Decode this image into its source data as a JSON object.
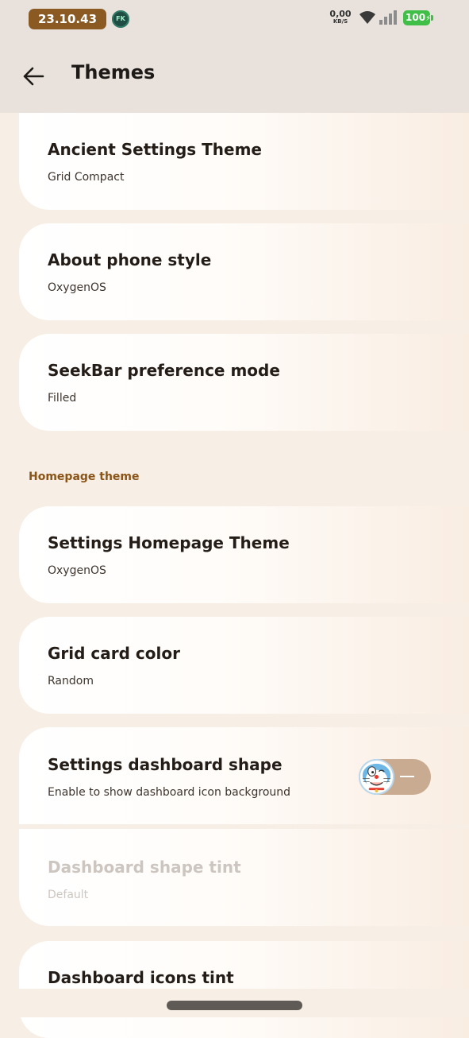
{
  "status_bar": {
    "time": "23.10.43",
    "badge": "FK",
    "net_speed_value": "0,00",
    "net_speed_unit": "KB/S",
    "battery": "100",
    "battery_color": "#3fbf47"
  },
  "app_bar": {
    "back_icon": "arrow-left-icon",
    "title": "Themes"
  },
  "cards_top": [
    {
      "title": "Ancient Settings Theme",
      "subtitle": "Grid Compact"
    },
    {
      "title": "About phone style",
      "subtitle": "OxygenOS"
    },
    {
      "title": "SeekBar preference mode",
      "subtitle": "Filled"
    }
  ],
  "section": {
    "title": "Homepage theme"
  },
  "cards_home": [
    {
      "title": "Settings Homepage Theme",
      "subtitle": "OxygenOS"
    },
    {
      "title": "Grid card color",
      "subtitle": "Random"
    },
    {
      "title": "Settings dashboard shape",
      "subtitle": "Enable to show dashboard icon background",
      "toggle_on": false
    },
    {
      "title": "Dashboard shape tint",
      "subtitle": "Default",
      "disabled": true
    },
    {
      "title": "Dashboard icons tint",
      "subtitle": ""
    }
  ],
  "colors": {
    "accent": "#8a5416",
    "background": "#f7eee6",
    "toggle_track": "#c9ab92"
  }
}
